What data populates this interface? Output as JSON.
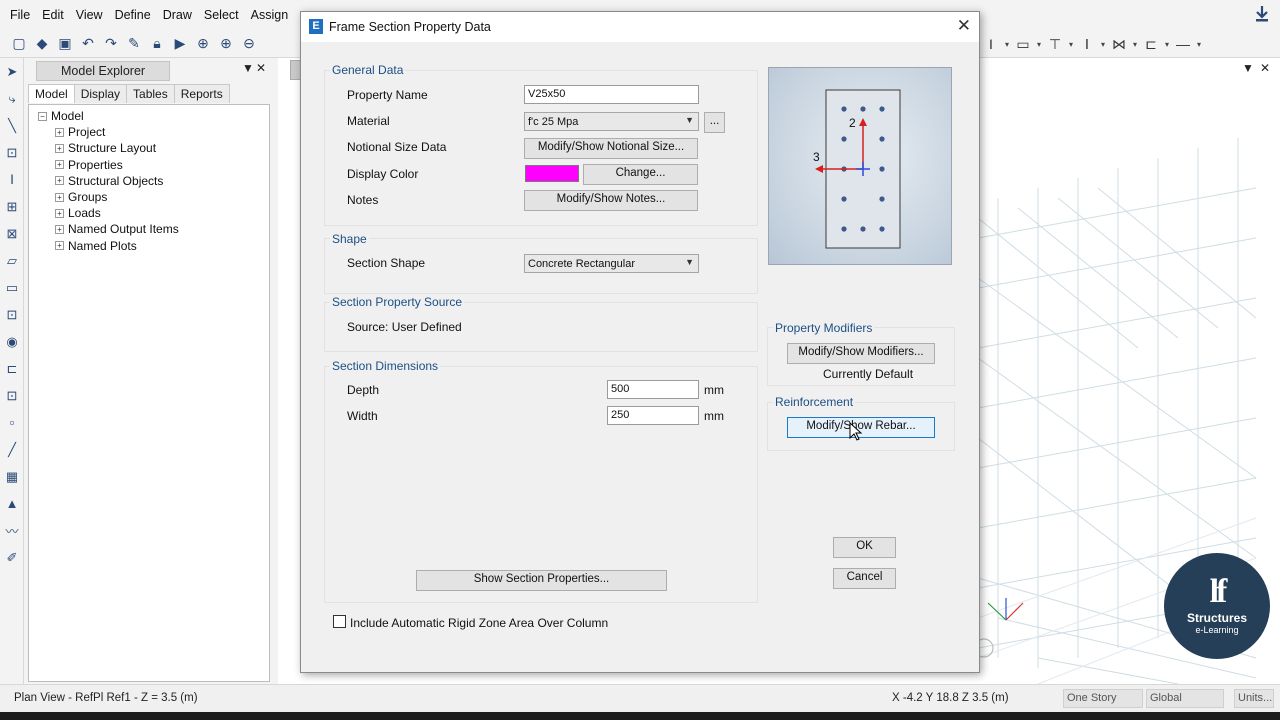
{
  "menu": [
    "File",
    "Edit",
    "View",
    "Define",
    "Draw",
    "Select",
    "Assign"
  ],
  "icons": {
    "download": "download-icon",
    "dialog_app": "etabs-e-icon",
    "close": "close-icon"
  },
  "explorer": {
    "title": "Model Explorer",
    "pin": "▼",
    "close": "✕",
    "tabs": [
      "Model",
      "Display",
      "Tables",
      "Reports"
    ],
    "tree_root": "Model",
    "tree_items": [
      "Project",
      "Structure Layout",
      "Properties",
      "Structural Objects",
      "Groups",
      "Loads",
      "Named Output Items",
      "Named Plots"
    ]
  },
  "dialog": {
    "title": "Frame Section Property Data",
    "general": {
      "group_label": "General Data",
      "property_name_label": "Property Name",
      "property_name_value": "V25x50",
      "material_label": "Material",
      "material_value": "f'c 25 Mpa",
      "material_more": "...",
      "notional_label": "Notional Size Data",
      "notional_button": "Modify/Show Notional Size...",
      "display_color_label": "Display Color",
      "display_color_value": "#ff00ff",
      "change_button": "Change...",
      "notes_label": "Notes",
      "notes_button": "Modify/Show Notes..."
    },
    "shape": {
      "group_label": "Shape",
      "section_shape_label": "Section Shape",
      "section_shape_value": "Concrete Rectangular"
    },
    "source": {
      "group_label": "Section Property Source",
      "source_text": "Source:  User Defined"
    },
    "dimensions": {
      "group_label": "Section Dimensions",
      "depth_label": "Depth",
      "depth_value": "500",
      "depth_unit": "mm",
      "width_label": "Width",
      "width_value": "250",
      "width_unit": "mm"
    },
    "preview": {
      "axis_2": "2",
      "axis_3": "3"
    },
    "modifiers": {
      "group_label": "Property Modifiers",
      "button": "Modify/Show Modifiers...",
      "status": "Currently Default"
    },
    "reinforcement": {
      "group_label": "Reinforcement",
      "button": "Modify/Show Rebar..."
    },
    "show_section_button": "Show Section Properties...",
    "rigid_zone_checkbox": "Include Automatic Rigid Zone Area Over Column",
    "rigid_zone_checked": false,
    "ok_button": "OK",
    "cancel_button": "Cancel"
  },
  "status": {
    "view_text": "Plan View - RefPl Ref1 - Z = 3.5 (m)",
    "coords": "X -4.2  Y 18.8  Z 3.5 (m)",
    "story_select": "One Story",
    "global_select": "Global",
    "units_button": "Units..."
  },
  "logo": {
    "mark": "lf",
    "line1": "Structures",
    "line2": "e-Learning"
  }
}
